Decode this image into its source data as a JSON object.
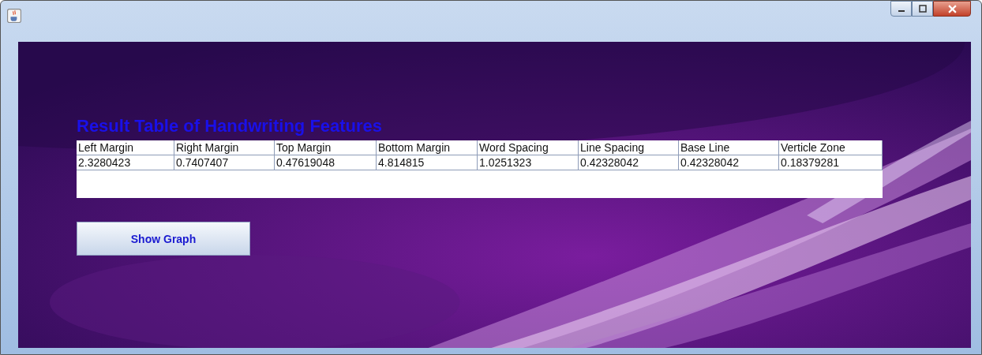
{
  "heading": "Result Table of Handwriting Features",
  "table": {
    "columns": [
      "Left Margin",
      "Right Margin",
      "Top Margin",
      "Bottom Margin",
      "Word Spacing",
      "Line Spacing",
      "Base Line",
      "Verticle Zone"
    ],
    "rows": [
      [
        "2.3280423",
        "0.7407407",
        "0.47619048",
        "4.814815",
        "1.0251323",
        "0.42328042",
        "0.42328042",
        "0.18379281"
      ]
    ]
  },
  "button": {
    "label": "Show Graph"
  }
}
